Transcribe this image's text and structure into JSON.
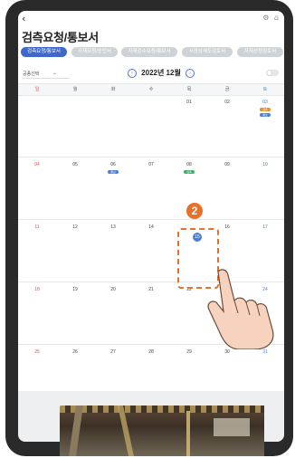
{
  "header": {
    "back": "‹",
    "title": "검측요청/통보서",
    "icons": [
      "⚙",
      "⌂"
    ]
  },
  "tabs": [
    {
      "label": "검측요청/통보서",
      "active": true
    },
    {
      "label": "자재요청/승인서",
      "active": false
    },
    {
      "label": "자재검수요청/통보서",
      "active": false
    },
    {
      "label": "시공상세도검토서",
      "active": false
    },
    {
      "label": "자재선정검토서",
      "active": false
    }
  ],
  "filter": {
    "value": "공종선택",
    "chevron": "⌄"
  },
  "calendar": {
    "month": "2022년 12월",
    "prev": "‹",
    "next": "›",
    "weekdays": [
      "일",
      "월",
      "화",
      "수",
      "목",
      "금",
      "토"
    ],
    "rows": [
      [
        "",
        "",
        "",
        "",
        "01",
        "02",
        "03"
      ],
      [
        "04",
        "05",
        "06",
        "07",
        "08",
        "09",
        "10"
      ],
      [
        "11",
        "12",
        "13",
        "14",
        "15",
        "16",
        "17"
      ],
      [
        "18",
        "19",
        "20",
        "21",
        "22",
        "23",
        "24"
      ],
      [
        "25",
        "26",
        "27",
        "28",
        "29",
        "30",
        "31"
      ]
    ],
    "badges": [
      {
        "text": "검측",
        "color": "#e8902a"
      },
      {
        "text": "통보",
        "color": "#4a7fd6"
      },
      {
        "text": "통보",
        "color": "#4a7fd6"
      },
      {
        "text": "검측",
        "color": "#39b06b"
      }
    ],
    "selected_day": "15"
  },
  "step": {
    "number": "2"
  },
  "colors": {
    "accent": "#3f68c9",
    "highlight": "#e8702a"
  }
}
